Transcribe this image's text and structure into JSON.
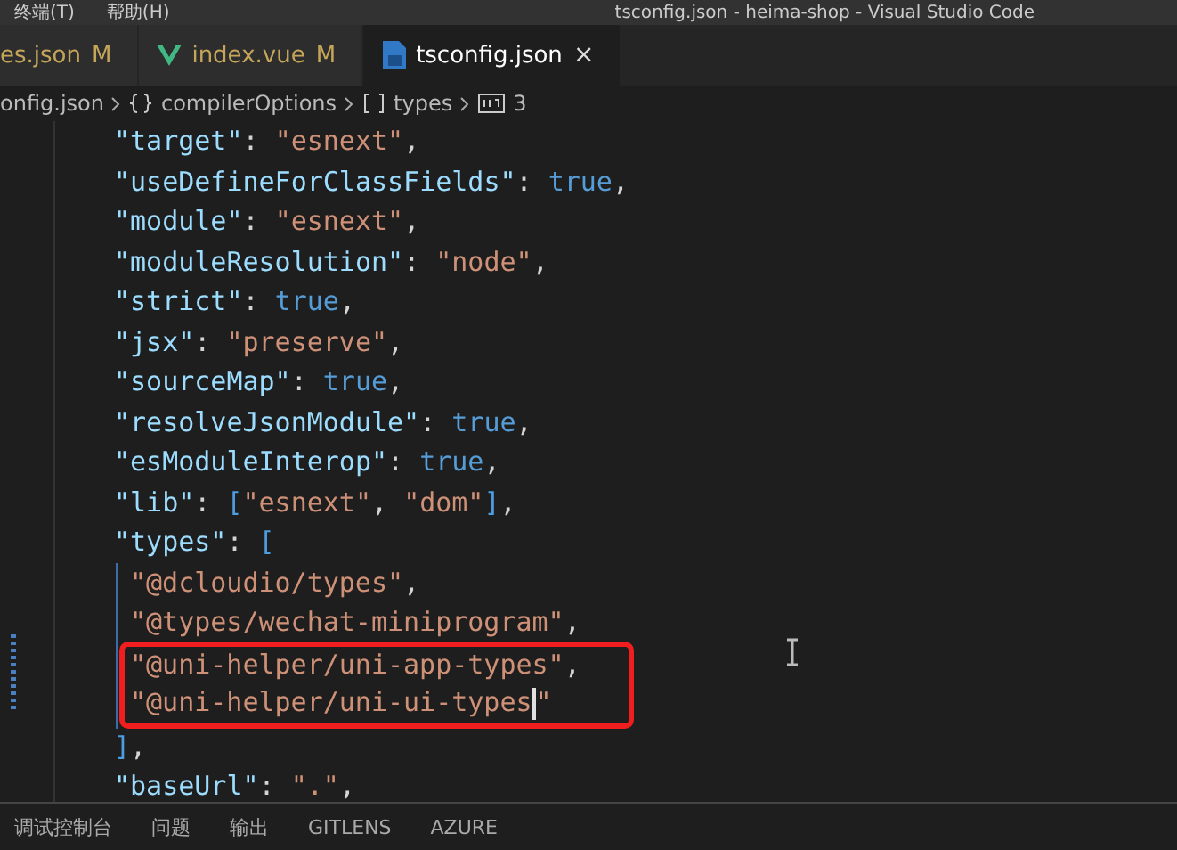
{
  "title_bar": {
    "menus": [
      "终端(T)",
      "帮助(H)"
    ],
    "title": "tsconfig.json - heima-shop - Visual Studio Code"
  },
  "tabs": [
    {
      "label": "es.json",
      "badge": "M",
      "selected": false
    },
    {
      "label": "index.vue",
      "badge": "M",
      "selected": false
    },
    {
      "label": "tsconfig.json",
      "selected": true,
      "close": "×"
    }
  ],
  "breadcrumb": [
    {
      "text": "onfig.json"
    },
    {
      "text": "compilerOptions"
    },
    {
      "text": "types"
    },
    {
      "text": "3"
    }
  ],
  "code": [
    {
      "tokens": [
        {
          "kind": "key",
          "text": "\"target\""
        },
        {
          "kind": "punct",
          "text": ": "
        },
        {
          "kind": "string",
          "text": "\"esnext\""
        },
        {
          "kind": "punct",
          "text": ","
        }
      ]
    },
    {
      "tokens": [
        {
          "kind": "key",
          "text": "\"useDefineForClassFields\""
        },
        {
          "kind": "punct",
          "text": ": "
        },
        {
          "kind": "bool",
          "text": "true"
        },
        {
          "kind": "punct",
          "text": ","
        }
      ]
    },
    {
      "tokens": [
        {
          "kind": "key",
          "text": "\"module\""
        },
        {
          "kind": "punct",
          "text": ": "
        },
        {
          "kind": "string",
          "text": "\"esnext\""
        },
        {
          "kind": "punct",
          "text": ","
        }
      ]
    },
    {
      "tokens": [
        {
          "kind": "key",
          "text": "\"moduleResolution\""
        },
        {
          "kind": "punct",
          "text": ": "
        },
        {
          "kind": "string",
          "text": "\"node\""
        },
        {
          "kind": "punct",
          "text": ","
        }
      ]
    },
    {
      "tokens": [
        {
          "kind": "key",
          "text": "\"strict\""
        },
        {
          "kind": "punct",
          "text": ": "
        },
        {
          "kind": "bool",
          "text": "true"
        },
        {
          "kind": "punct",
          "text": ","
        }
      ]
    },
    {
      "tokens": [
        {
          "kind": "key",
          "text": "\"jsx\""
        },
        {
          "kind": "punct",
          "text": ": "
        },
        {
          "kind": "string",
          "text": "\"preserve\""
        },
        {
          "kind": "punct",
          "text": ","
        }
      ]
    },
    {
      "tokens": [
        {
          "kind": "key",
          "text": "\"sourceMap\""
        },
        {
          "kind": "punct",
          "text": ": "
        },
        {
          "kind": "bool",
          "text": "true"
        },
        {
          "kind": "punct",
          "text": ","
        }
      ]
    },
    {
      "tokens": [
        {
          "kind": "key",
          "text": "\"resolveJsonModule\""
        },
        {
          "kind": "punct",
          "text": ": "
        },
        {
          "kind": "bool",
          "text": "true"
        },
        {
          "kind": "punct",
          "text": ","
        }
      ]
    },
    {
      "tokens": [
        {
          "kind": "key",
          "text": "\"esModuleInterop\""
        },
        {
          "kind": "punct",
          "text": ": "
        },
        {
          "kind": "bool",
          "text": "true"
        },
        {
          "kind": "punct",
          "text": ","
        }
      ]
    },
    {
      "tokens": [
        {
          "kind": "key",
          "text": "\"lib\""
        },
        {
          "kind": "punct",
          "text": ": "
        },
        {
          "kind": "bracket",
          "text": "["
        },
        {
          "kind": "string",
          "text": "\"esnext\""
        },
        {
          "kind": "punct",
          "text": ", "
        },
        {
          "kind": "string",
          "text": "\"dom\""
        },
        {
          "kind": "bracket",
          "text": "]"
        },
        {
          "kind": "punct",
          "text": ","
        }
      ]
    },
    {
      "tokens": [
        {
          "kind": "key",
          "text": "\"types\""
        },
        {
          "kind": "punct",
          "text": ": "
        },
        {
          "kind": "bracket",
          "text": "["
        }
      ],
      "children": [
        {
          "highlighted": false,
          "tokens": [
            {
              "kind": "string",
              "text": "\"@dcloudio/types\""
            },
            {
              "kind": "punct",
              "text": ","
            }
          ]
        },
        {
          "highlighted": false,
          "tokens": [
            {
              "kind": "string",
              "text": "\"@types/wechat-miniprogram\""
            },
            {
              "kind": "punct",
              "text": ","
            }
          ]
        },
        {
          "highlighted": true,
          "tokens": [
            {
              "kind": "string",
              "text": "\"@uni-helper/uni-app-types\""
            },
            {
              "kind": "punct",
              "text": ","
            }
          ]
        },
        {
          "highlighted": true,
          "tokens": [
            {
              "kind": "string",
              "text": "\"@uni-helper/uni-ui-types"
            },
            {
              "kind": "caret"
            },
            {
              "kind": "string",
              "text": "\""
            }
          ]
        }
      ]
    },
    {
      "tokens": [
        {
          "kind": "bracket",
          "text": "]"
        },
        {
          "kind": "punct",
          "text": ","
        }
      ]
    },
    {
      "tokens": [
        {
          "kind": "key",
          "text": "\"baseUrl\""
        },
        {
          "kind": "punct",
          "text": ": "
        },
        {
          "kind": "string",
          "text": "\".\""
        },
        {
          "kind": "punct",
          "text": ","
        }
      ]
    }
  ],
  "panel_tabs": [
    "调试控制台",
    "问题",
    "输出",
    "GITLENS",
    "AZURE"
  ]
}
